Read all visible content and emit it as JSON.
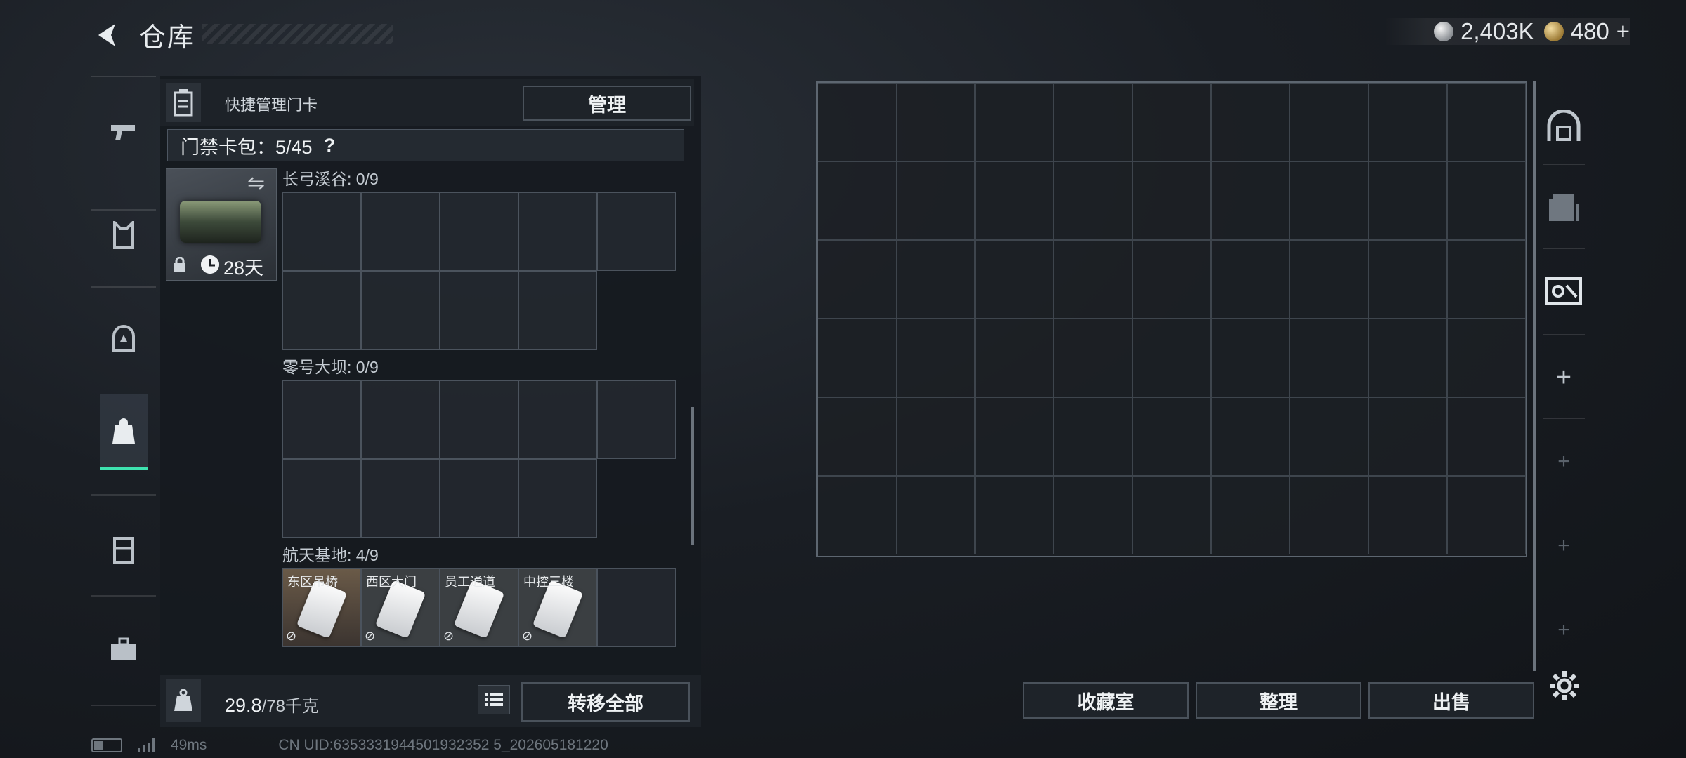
{
  "header": {
    "title": "仓库",
    "currency": [
      {
        "icon": "silver-coin-icon",
        "value": "2,403K"
      },
      {
        "icon": "gold-coin-icon",
        "value": "480"
      }
    ],
    "add_label": "+"
  },
  "sidebar": {
    "items": [
      {
        "icon": "pistol-icon"
      },
      {
        "icon": "armor-vest-icon"
      },
      {
        "icon": "helmet-icon"
      },
      {
        "icon": "backpack-icon",
        "active": true
      },
      {
        "icon": "chest-rig-icon"
      },
      {
        "icon": "toolbox-icon"
      }
    ]
  },
  "card_panel": {
    "header_label": "快捷管理门卡",
    "manage_label": "管理",
    "pack_label": "门禁卡包：5/45",
    "help_label": "?",
    "card_duration": "28天",
    "regions": [
      {
        "label": "长弓溪谷: 0/9",
        "keys": []
      },
      {
        "label": "零号大坝: 0/9",
        "keys": []
      },
      {
        "label": "航天基地: 4/9",
        "keys": [
          "东区吊桥",
          "西区大门",
          "员工通道",
          "中控三楼"
        ]
      }
    ]
  },
  "footer_left": {
    "weight_current": "29.8",
    "weight_max": "/78千克",
    "transfer_all_label": "转移全部"
  },
  "footer_right": {
    "buttons": [
      "收藏室",
      "整理",
      "出售"
    ]
  },
  "right_nav": {
    "items": [
      "vault-icon",
      "storage-box-icon",
      "key-card-box-icon",
      "+",
      "+",
      "+",
      "+"
    ]
  },
  "status_bar": {
    "ping": "49ms",
    "uid": "CN UID:6353331944501932352 5_202605181220"
  }
}
